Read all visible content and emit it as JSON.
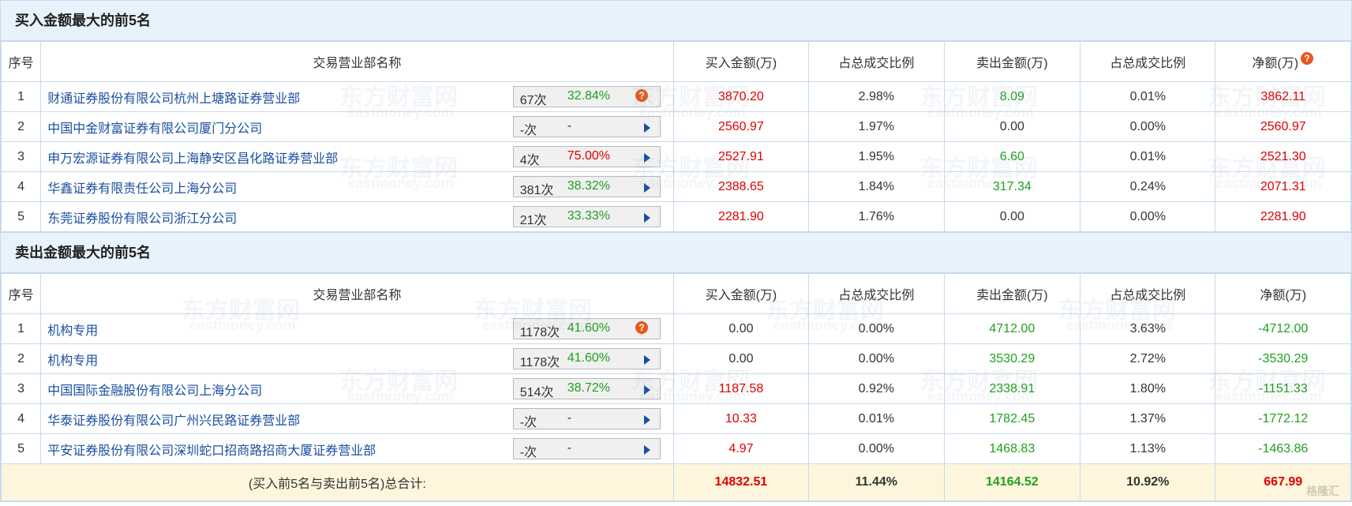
{
  "buy_section": {
    "title": "买入金额最大的前5名",
    "headers": [
      "序号",
      "交易营业部名称",
      "买入金额(万)",
      "占总成交比例",
      "卖出金额(万)",
      "占总成交比例",
      "净额(万)"
    ],
    "rows": [
      {
        "idx": "1",
        "name": "财通证券股份有限公司杭州上塘路证券营业部",
        "count": "67次",
        "rate": "32.84%",
        "buy": "3870.20",
        "buy_pct": "2.98%",
        "sell": "8.09",
        "sell_pct": "0.01%",
        "net": "3862.11"
      },
      {
        "idx": "2",
        "name": "中国中金财富证券有限公司厦门分公司",
        "count": "-次",
        "rate": "-",
        "buy": "2560.97",
        "buy_pct": "1.97%",
        "sell": "0.00",
        "sell_pct": "0.00%",
        "net": "2560.97"
      },
      {
        "idx": "3",
        "name": "申万宏源证券有限公司上海静安区昌化路证券营业部",
        "count": "4次",
        "rate": "75.00%",
        "buy": "2527.91",
        "buy_pct": "1.95%",
        "sell": "6.60",
        "sell_pct": "0.01%",
        "net": "2521.30"
      },
      {
        "idx": "4",
        "name": "华鑫证券有限责任公司上海分公司",
        "count": "381次",
        "rate": "38.32%",
        "buy": "2388.65",
        "buy_pct": "1.84%",
        "sell": "317.34",
        "sell_pct": "0.24%",
        "net": "2071.31"
      },
      {
        "idx": "5",
        "name": "东莞证券股份有限公司浙江分公司",
        "count": "21次",
        "rate": "33.33%",
        "buy": "2281.90",
        "buy_pct": "1.76%",
        "sell": "0.00",
        "sell_pct": "0.00%",
        "net": "2281.90"
      }
    ]
  },
  "sell_section": {
    "title": "卖出金额最大的前5名",
    "headers": [
      "序号",
      "交易营业部名称",
      "买入金额(万)",
      "占总成交比例",
      "卖出金额(万)",
      "占总成交比例",
      "净额(万)"
    ],
    "rows": [
      {
        "idx": "1",
        "name": "机构专用",
        "count": "1178次",
        "rate": "41.60%",
        "buy": "0.00",
        "buy_pct": "0.00%",
        "sell": "4712.00",
        "sell_pct": "3.63%",
        "net": "-4712.00"
      },
      {
        "idx": "2",
        "name": "机构专用",
        "count": "1178次",
        "rate": "41.60%",
        "buy": "0.00",
        "buy_pct": "0.00%",
        "sell": "3530.29",
        "sell_pct": "2.72%",
        "net": "-3530.29"
      },
      {
        "idx": "3",
        "name": "中国国际金融股份有限公司上海分公司",
        "count": "514次",
        "rate": "38.72%",
        "buy": "1187.58",
        "buy_pct": "0.92%",
        "sell": "2338.91",
        "sell_pct": "1.80%",
        "net": "-1151.33"
      },
      {
        "idx": "4",
        "name": "华泰证券股份有限公司广州兴民路证券营业部",
        "count": "-次",
        "rate": "-",
        "buy": "10.33",
        "buy_pct": "0.01%",
        "sell": "1782.45",
        "sell_pct": "1.37%",
        "net": "-1772.12"
      },
      {
        "idx": "5",
        "name": "平安证券股份有限公司深圳蛇口招商路招商大厦证券营业部",
        "count": "-次",
        "rate": "-",
        "buy": "4.97",
        "buy_pct": "0.00%",
        "sell": "1468.83",
        "sell_pct": "1.13%",
        "net": "-1463.86"
      }
    ],
    "total": {
      "label": "(买入前5名与卖出前5名)总合计:",
      "buy": "14832.51",
      "buy_pct": "11.44%",
      "sell": "14164.52",
      "sell_pct": "10.92%",
      "net": "667.99"
    }
  },
  "watermark": {
    "cn": "东方财富网",
    "en": "eastmoney.com",
    "corner": "格隆汇"
  },
  "colors": {
    "buy": "#e00000",
    "sell": "#20a020",
    "link": "#1a4fa0",
    "header_bg": "#e8f2fb",
    "total_bg": "#fdf6dc",
    "help_icon": "#e8581c"
  }
}
